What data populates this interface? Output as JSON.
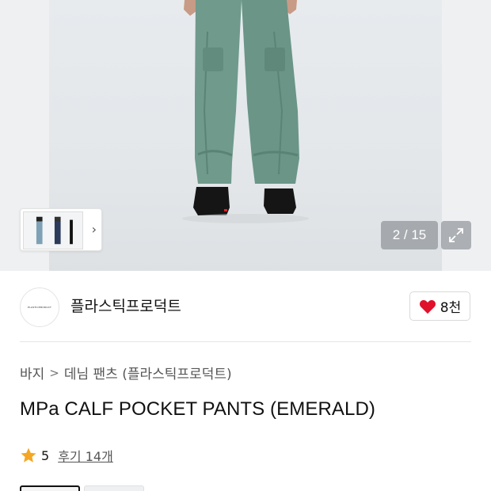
{
  "gallery": {
    "counter": "2 / 15",
    "expand_icon": "expand-arrows-icon",
    "thumb_arrow": "›"
  },
  "brand": {
    "name": "플라스틱프로덕트",
    "logo_text": "PLASTICPRODUCT",
    "like_icon": "heart-icon",
    "like_color": "#e0112b",
    "like_count": "8천"
  },
  "breadcrumb": {
    "items": [
      "바지",
      "데님 팬츠 (플라스틱프로덕트)"
    ],
    "separator": ">"
  },
  "product": {
    "title": "MPa CALF POCKET PANTS (EMERALD)",
    "rating_icon": "star-icon",
    "rating_color": "#f5a623",
    "rating": "5",
    "reviews": "후기 14개"
  },
  "colors": {
    "pants": "#6f9a8c",
    "background": "#e6eaed"
  }
}
